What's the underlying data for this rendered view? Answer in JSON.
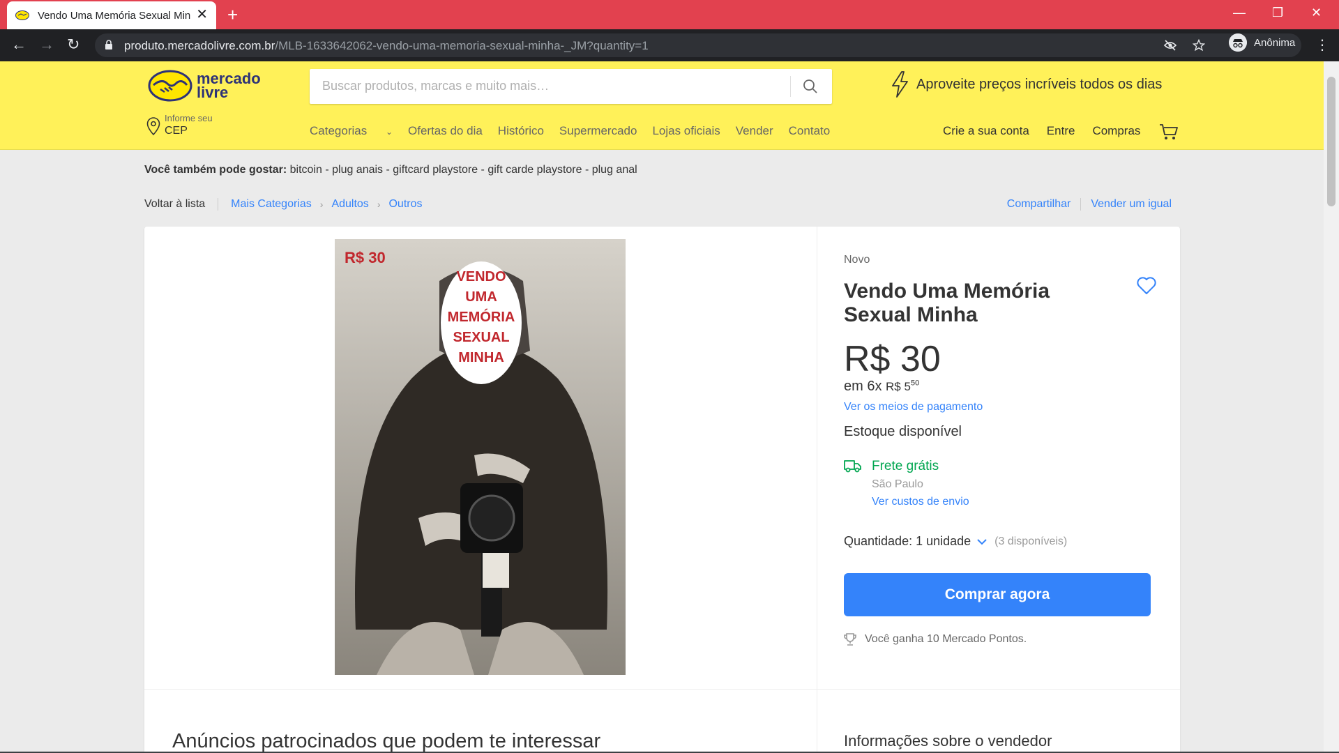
{
  "browser": {
    "tab_title": "Vendo Uma Memória Sexual Minha",
    "tab_close": "✕",
    "new_tab": "+",
    "url_host": "produto.mercadolivre.com.br",
    "url_path": "/MLB-1633642062-vendo-uma-memoria-sexual-minha-_JM?quantity=1",
    "profile_label": "Anônima",
    "theme_color": "#e2414f"
  },
  "header": {
    "brand_color": "#fff159",
    "logo_line1": "mercado",
    "logo_line2": "livre",
    "search_placeholder": "Buscar produtos, marcas e muito mais…",
    "promo": "Aproveite preços incríveis todos os dias",
    "location_label": "Informe seu",
    "location_value": "CEP",
    "nav": [
      "Categorias",
      "Ofertas do dia",
      "Histórico",
      "Supermercado",
      "Lojas oficiais",
      "Vender",
      "Contato"
    ],
    "user_nav": [
      "Crie a sua conta",
      "Entre",
      "Compras"
    ]
  },
  "suggestions": {
    "label": "Você também pode gostar:",
    "text": "bitcoin - plug anais - giftcard playstore - gift carde playstore - plug anal"
  },
  "breadcrumb": {
    "back": "Voltar à lista",
    "items": [
      "Mais Categorias",
      "Adultos",
      "Outros"
    ],
    "share": "Compartilhar",
    "sell_same": "Vender um igual"
  },
  "image": {
    "price_tag": "R$ 30",
    "overlay_lines": [
      "VENDO",
      "UMA",
      "MEMÓRIA",
      "SEXUAL",
      "MINHA"
    ]
  },
  "product": {
    "condition": "Novo",
    "title": "Vendo Uma Memória Sexual Minha",
    "price": "R$ 30",
    "installments_prefix": "em 6x",
    "installment_value": "R$ 5",
    "installment_cents": "50",
    "payment_link": "Ver os meios de pagamento",
    "stock": "Estoque disponível",
    "shipping": "Frete grátis",
    "shipping_city": "São Paulo",
    "shipping_link": "Ver custos de envio",
    "quantity_label": "Quantidade:",
    "quantity_value": "1 unidade",
    "available": "(3 disponíveis)",
    "buy_button": "Comprar agora",
    "points": "Você ganha 10 Mercado Pontos.",
    "accent_color": "#3483fa",
    "free_shipping_color": "#00a650"
  },
  "sections": {
    "sponsored": "Anúncios patrocinados que podem te interessar",
    "seller_info": "Informações sobre o vendedor"
  }
}
